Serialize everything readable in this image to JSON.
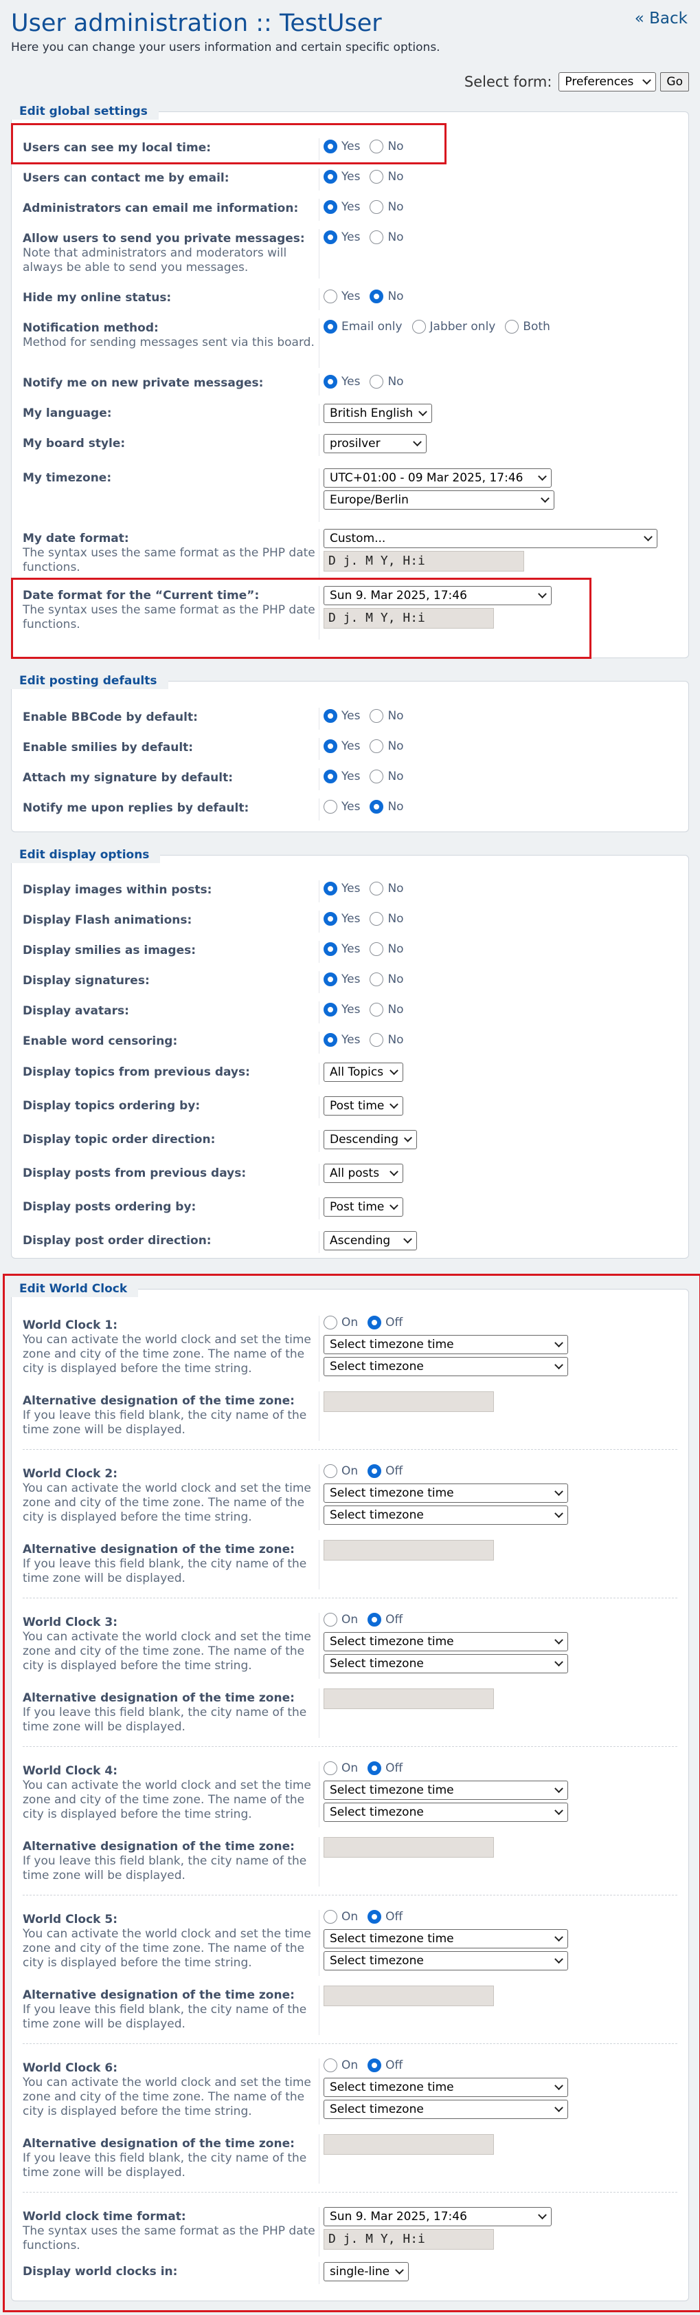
{
  "header": {
    "back": "« Back",
    "title": "User administration :: TestUser",
    "subtitle": "Here you can change your users information and certain specific options.",
    "select_form_label": "Select form:",
    "select_form_value": "Preferences",
    "go": "Go"
  },
  "radio_labels": {
    "yes": "Yes",
    "no": "No",
    "on": "On",
    "off": "Off"
  },
  "global": {
    "title": "Edit global settings",
    "local_time": {
      "label": "Users can see my local time:",
      "value": "Yes"
    },
    "contact_email": {
      "label": "Users can contact me by email:",
      "value": "Yes"
    },
    "admin_email": {
      "label": "Administrators can email me information:",
      "value": "Yes"
    },
    "private_msgs": {
      "label": "Allow users to send you private messages:",
      "desc": "Note that administrators and moderators will always be able to send you messages.",
      "value": "Yes"
    },
    "hide_online": {
      "label": "Hide my online status:",
      "value": "No"
    },
    "notify_method": {
      "label": "Notification method:",
      "desc": "Method for sending messages sent via this board.",
      "opt_email": "Email only",
      "opt_jabber": "Jabber only",
      "opt_both": "Both",
      "value": "Email only"
    },
    "notify_pm": {
      "label": "Notify me on new private messages:",
      "value": "Yes"
    },
    "language": {
      "label": "My language:",
      "value": "British English"
    },
    "style": {
      "label": "My board style:",
      "value": "prosilver"
    },
    "timezone": {
      "label": "My timezone:",
      "value1": "UTC+01:00 - 09 Mar 2025, 17:46",
      "value2": "Europe/Berlin"
    },
    "date_format": {
      "label": "My date format:",
      "desc": "The syntax uses the same format as the PHP date functions.",
      "select": "Custom...",
      "input": "D j. M Y, H:i"
    },
    "current_time_format": {
      "label": "Date format for the “Current time”:",
      "desc": "The syntax uses the same format as the PHP date functions.",
      "select": "Sun 9. Mar 2025, 17:46",
      "input": "D j. M Y, H:i"
    }
  },
  "posting": {
    "title": "Edit posting defaults",
    "bbcode": {
      "label": "Enable BBCode by default:",
      "value": "Yes"
    },
    "smilies": {
      "label": "Enable smilies by default:",
      "value": "Yes"
    },
    "signature": {
      "label": "Attach my signature by default:",
      "value": "Yes"
    },
    "notify_replies": {
      "label": "Notify me upon replies by default:",
      "value": "No"
    }
  },
  "display": {
    "title": "Edit display options",
    "images": {
      "label": "Display images within posts:",
      "value": "Yes"
    },
    "flash": {
      "label": "Display Flash animations:",
      "value": "Yes"
    },
    "smilies_img": {
      "label": "Display smilies as images:",
      "value": "Yes"
    },
    "signatures": {
      "label": "Display signatures:",
      "value": "Yes"
    },
    "avatars": {
      "label": "Display avatars:",
      "value": "Yes"
    },
    "censor": {
      "label": "Enable word censoring:",
      "value": "Yes"
    },
    "topic_days": {
      "label": "Display topics from previous days:",
      "value": "All Topics"
    },
    "topic_order": {
      "label": "Display topics ordering by:",
      "value": "Post time"
    },
    "topic_dir": {
      "label": "Display topic order direction:",
      "value": "Descending"
    },
    "post_days": {
      "label": "Display posts from previous days:",
      "value": "All posts"
    },
    "post_order": {
      "label": "Display posts ordering by:",
      "value": "Post time"
    },
    "post_dir": {
      "label": "Display post order direction:",
      "value": "Ascending"
    }
  },
  "world_clock": {
    "title": "Edit World Clock",
    "clock_desc": "You can activate the world clock and set the time zone and city of the time zone. The name of the city is displayed before the time string.",
    "tz_time_select": "Select timezone time",
    "tz_select": "Select timezone",
    "alt_label": "Alternative designation of the time zone:",
    "alt_desc": "If you leave this field blank, the city name of the time zone will be displayed.",
    "clocks": [
      {
        "label": "World Clock 1:",
        "value": "Off"
      },
      {
        "label": "World Clock 2:",
        "value": "Off"
      },
      {
        "label": "World Clock 3:",
        "value": "Off"
      },
      {
        "label": "World Clock 4:",
        "value": "Off"
      },
      {
        "label": "World Clock 5:",
        "value": "Off"
      },
      {
        "label": "World Clock 6:",
        "value": "Off"
      }
    ],
    "time_format": {
      "label": "World clock time format:",
      "desc": "The syntax uses the same format as the PHP date functions.",
      "select": "Sun 9. Mar 2025, 17:46",
      "input": "D j. M Y, H:i"
    },
    "display_in": {
      "label": "Display world clocks in:",
      "value": "single-line"
    }
  },
  "colors": {
    "title": "#115098",
    "accent": "#0d6bd6",
    "highlight": "#d8171f"
  }
}
